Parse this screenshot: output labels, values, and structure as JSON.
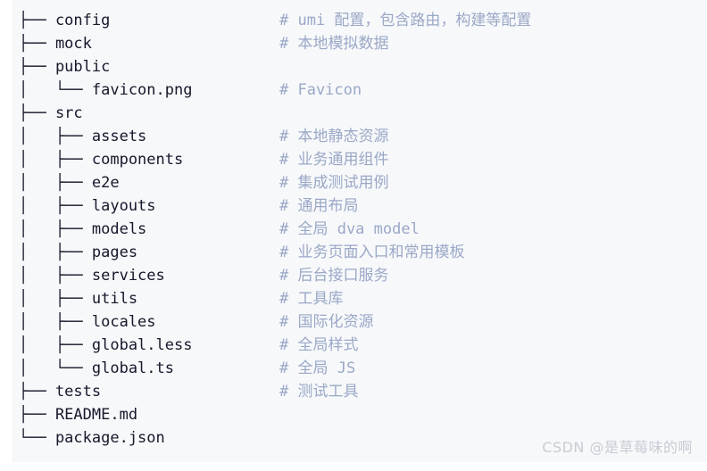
{
  "panel": {
    "background_color": "#f7f8fa",
    "text_color": "#16182b",
    "comment_color": "#9aa8c7"
  },
  "tree": {
    "rows": [
      {
        "path": "├── config",
        "comment": "# umi 配置，包含路由，构建等配置"
      },
      {
        "path": "├── mock",
        "comment": "# 本地模拟数据"
      },
      {
        "path": "├── public",
        "comment": ""
      },
      {
        "path": "│   └── favicon.png",
        "comment": "# Favicon"
      },
      {
        "path": "├── src",
        "comment": ""
      },
      {
        "path": "│   ├── assets",
        "comment": "# 本地静态资源"
      },
      {
        "path": "│   ├── components",
        "comment": "# 业务通用组件"
      },
      {
        "path": "│   ├── e2e",
        "comment": "# 集成测试用例"
      },
      {
        "path": "│   ├── layouts",
        "comment": "# 通用布局"
      },
      {
        "path": "│   ├── models",
        "comment": "# 全局 dva model"
      },
      {
        "path": "│   ├── pages",
        "comment": "# 业务页面入口和常用模板"
      },
      {
        "path": "│   ├── services",
        "comment": "# 后台接口服务"
      },
      {
        "path": "│   ├── utils",
        "comment": "# 工具库"
      },
      {
        "path": "│   ├── locales",
        "comment": "# 国际化资源"
      },
      {
        "path": "│   ├── global.less",
        "comment": "# 全局样式"
      },
      {
        "path": "│   └── global.ts",
        "comment": "# 全局 JS"
      },
      {
        "path": "├── tests",
        "comment": "# 测试工具"
      },
      {
        "path": "├── README.md",
        "comment": ""
      },
      {
        "path": "└── package.json",
        "comment": ""
      }
    ]
  },
  "watermark": {
    "text": "CSDN @是草莓味的啊"
  }
}
